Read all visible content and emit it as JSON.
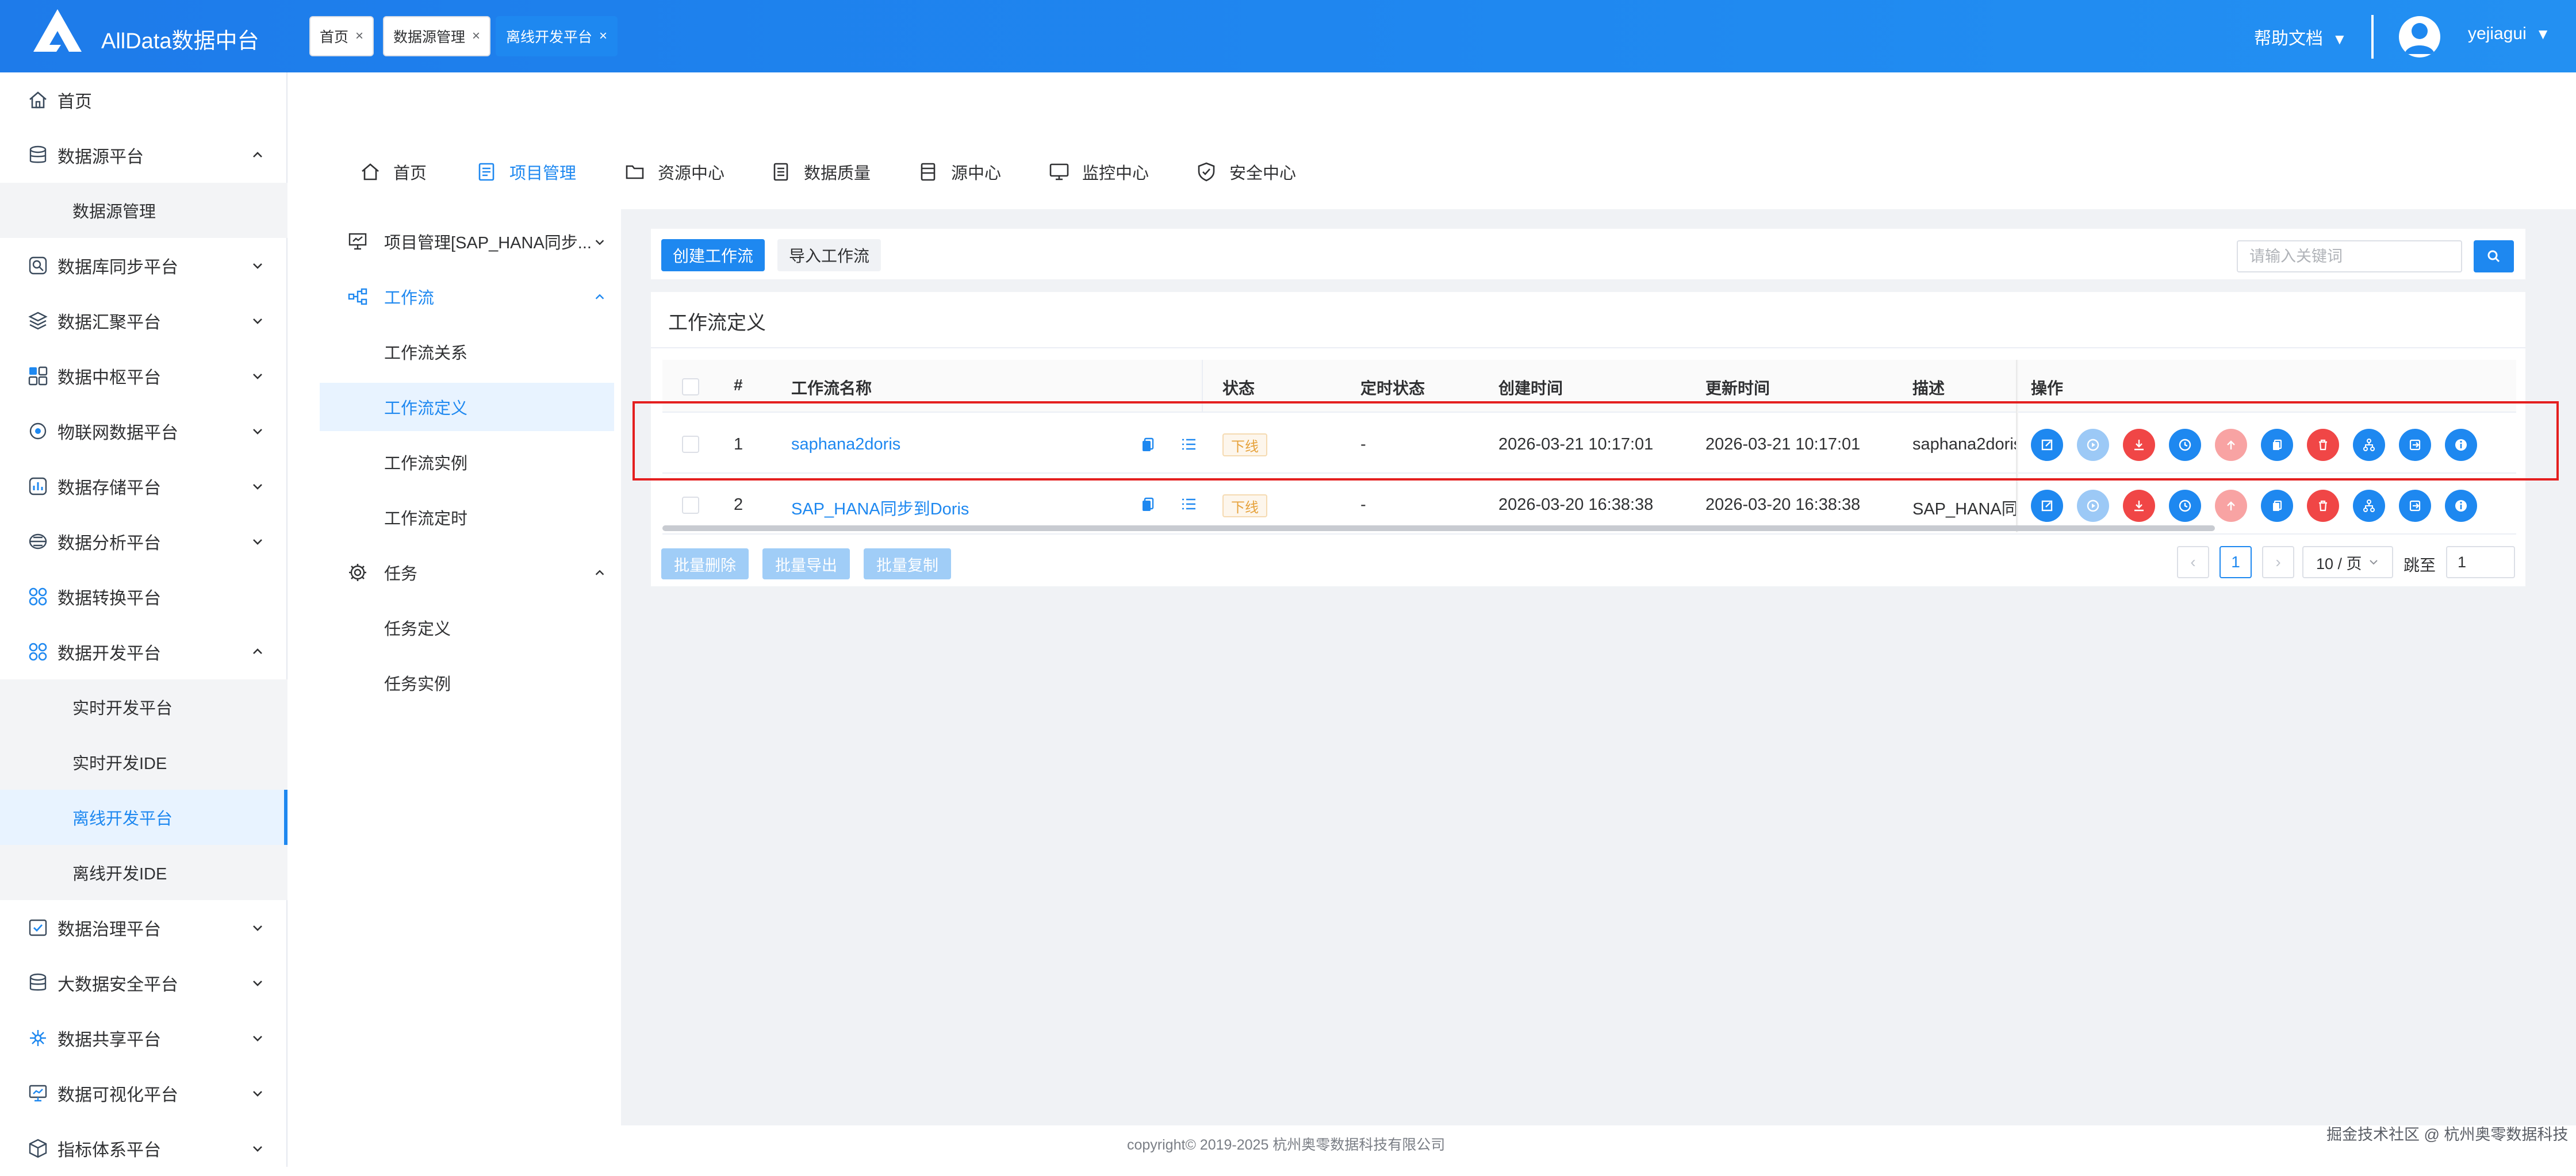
{
  "header": {
    "app_title": "AllData数据中台",
    "help_label": "帮助文档",
    "help_caret": "▼",
    "username": "yejiagui",
    "user_caret": "▼"
  },
  "sidebar": {
    "items": [
      {
        "label": "首页",
        "icon": "home-icon"
      },
      {
        "label": "数据源平台",
        "icon": "database-icon",
        "expanded": true
      },
      {
        "label": "数据源管理",
        "sub": true
      },
      {
        "label": "数据库同步平台",
        "icon": "sync-icon"
      },
      {
        "label": "数据汇聚平台",
        "icon": "layers-icon"
      },
      {
        "label": "数据中枢平台",
        "icon": "hub-icon"
      },
      {
        "label": "物联网数据平台",
        "icon": "iot-icon"
      },
      {
        "label": "数据存储平台",
        "icon": "chart-icon"
      },
      {
        "label": "数据分析平台",
        "icon": "analysis-icon"
      },
      {
        "label": "数据转换平台",
        "icon": "transform-icon"
      },
      {
        "label": "数据开发平台",
        "icon": "develop-icon",
        "expanded": true
      },
      {
        "label": "实时开发平台",
        "sub": true
      },
      {
        "label": "实时开发IDE",
        "sub": true
      },
      {
        "label": "离线开发平台",
        "sub": true,
        "active": true
      },
      {
        "label": "离线开发IDE",
        "sub": true
      },
      {
        "label": "数据治理平台",
        "icon": "govern-icon"
      },
      {
        "label": "大数据安全平台",
        "icon": "security-icon"
      },
      {
        "label": "数据共享平台",
        "icon": "share-icon"
      },
      {
        "label": "数据可视化平台",
        "icon": "visual-icon"
      },
      {
        "label": "指标体系平台",
        "icon": "cube-icon"
      }
    ]
  },
  "tabs": [
    {
      "label": "首页"
    },
    {
      "label": "数据源管理"
    },
    {
      "label": "离线开发平台",
      "active": true
    }
  ],
  "tab_close": "×",
  "top_menu": [
    {
      "label": "首页",
      "icon": "home-icon"
    },
    {
      "label": "项目管理",
      "icon": "project-icon",
      "active": true
    },
    {
      "label": "资源中心",
      "icon": "folder-icon"
    },
    {
      "label": "数据质量",
      "icon": "quality-icon"
    },
    {
      "label": "源中心",
      "icon": "source-icon"
    },
    {
      "label": "监控中心",
      "icon": "monitor-icon"
    },
    {
      "label": "安全中心",
      "icon": "shield-icon"
    }
  ],
  "sub_sidebar": {
    "project": "项目管理[SAP_HANA同步...",
    "workflow": "工作流",
    "workflow_items": [
      "工作流关系",
      "工作流定义",
      "工作流实例",
      "工作流定时"
    ],
    "task": "任务",
    "task_items": [
      "任务定义",
      "任务实例"
    ]
  },
  "toolbar": {
    "create_label": "创建工作流",
    "import_label": "导入工作流",
    "search_placeholder": "请输入关键词"
  },
  "panel_title": "工作流定义",
  "table": {
    "columns": [
      "#",
      "工作流名称",
      "状态",
      "定时状态",
      "创建时间",
      "更新时间",
      "描述",
      "操作"
    ],
    "rows": [
      {
        "index": "1",
        "name": "saphana2doris",
        "status": "下线",
        "schedule": "-",
        "created": "2026-03-21 10:17:01",
        "updated": "2026-03-21 10:17:01",
        "desc": "saphana2doris"
      },
      {
        "index": "2",
        "name": "SAP_HANA同步到Doris",
        "status": "下线",
        "schedule": "-",
        "created": "2026-03-20 16:38:38",
        "updated": "2026-03-20 16:38:38",
        "desc": "SAP_HANA同步"
      }
    ],
    "actions": [
      "edit-icon",
      "run-icon",
      "download-icon",
      "timer-icon",
      "upload-icon",
      "copy-icon",
      "delete-icon",
      "tree-icon",
      "export-icon",
      "info-icon"
    ],
    "action_colors": {
      "blue": "#1e88f0",
      "lightblue": "#9cc9f6",
      "red": "#f04646",
      "pink": "#f8a3a3"
    }
  },
  "batch": {
    "delete_label": "批量删除",
    "export_label": "批量导出",
    "copy_label": "批量复制"
  },
  "pagination": {
    "prev": "‹",
    "next": "›",
    "current_page": "1",
    "page_size": "10 / 页",
    "goto_label": "跳至",
    "goto_value": "1"
  },
  "footer": {
    "copyright": "copyright© 2019-2025 杭州奥零数据科技有限公司",
    "watermark": "掘金技术社区 @ 杭州奥零数据科技"
  },
  "colors": {
    "accent": "#1e88f0",
    "header": "#1f88f0",
    "warning": "#e6a23c",
    "danger": "#f04646"
  }
}
